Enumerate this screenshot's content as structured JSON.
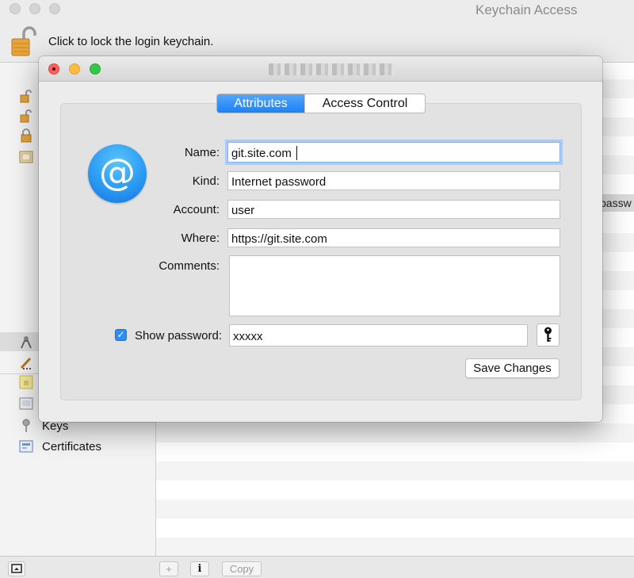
{
  "background_window": {
    "title": "Keychain Access",
    "lock_message": "Click to lock the login keychain.",
    "categories": [
      {
        "label": "",
        "icon": "all-items-icon"
      },
      {
        "label": "",
        "icon": "passwords-icon"
      },
      {
        "label": "",
        "icon": "secure-notes-icon"
      },
      {
        "label": "",
        "icon": "my-certificates-icon"
      },
      {
        "label": "Keys",
        "icon": "key-icon"
      },
      {
        "label": "Certificates",
        "icon": "certificate-icon"
      }
    ],
    "list_peek_text": "passw",
    "bottom_bar": {
      "add_label": "+",
      "info_label": "i",
      "copy_label": "Copy"
    }
  },
  "dialog": {
    "tabs": [
      {
        "label": "Attributes",
        "active": true
      },
      {
        "label": "Access Control",
        "active": false
      }
    ],
    "item_icon": "at-sign-icon",
    "item_icon_glyph": "@",
    "fields": {
      "name": {
        "label": "Name:",
        "value": "git.site.com"
      },
      "kind": {
        "label": "Kind:",
        "value": "Internet password"
      },
      "account": {
        "label": "Account:",
        "value": "user"
      },
      "where": {
        "label": "Where:",
        "value": "https://git.site.com"
      },
      "comments": {
        "label": "Comments:",
        "value": ""
      }
    },
    "show_password": {
      "label": "Show password:",
      "checked": true,
      "value": "xxxxx"
    },
    "save_label": "Save Changes"
  },
  "colors": {
    "accent": "#1a82f5",
    "close": "#fc605c",
    "minimize": "#fdbc40",
    "maximize": "#34c84a"
  }
}
